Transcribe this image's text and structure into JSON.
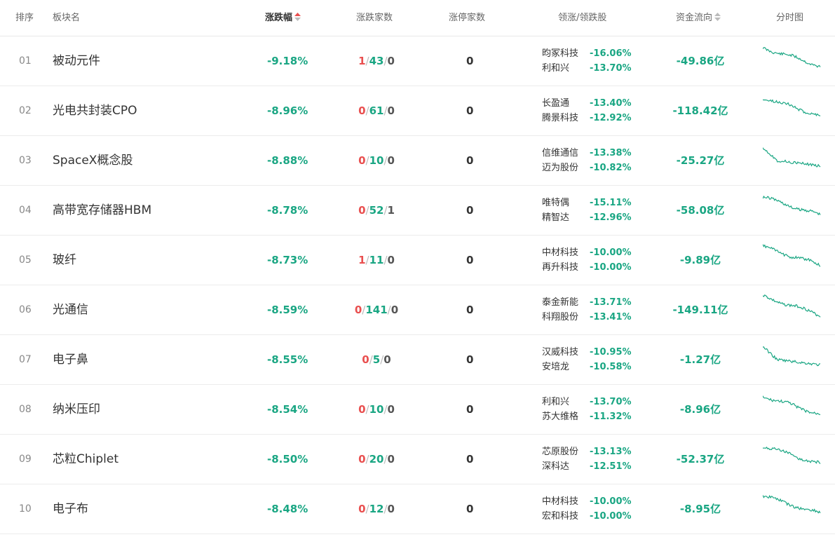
{
  "headers": {
    "rank": "排序",
    "name": "板块名",
    "pct": "涨跌幅",
    "counts": "涨跌家数",
    "limit_up": "涨停家数",
    "leaders": "领涨/领跌股",
    "flow": "资金流向",
    "chart": "分时图"
  },
  "colors": {
    "down": "#1aa683",
    "up": "#e94f4f",
    "sort_active": "#e94f4f",
    "sort_inactive": "#bbbbbb"
  },
  "rows": [
    {
      "rank": "01",
      "name": "被动元件",
      "pct": "-9.18%",
      "up": "1",
      "down": "43",
      "flat": "0",
      "limit_up": "0",
      "leaders": [
        {
          "name": "昀冢科技",
          "pct": "-16.06%"
        },
        {
          "name": "利和兴",
          "pct": "-13.70%"
        }
      ],
      "flow": "-49.86亿"
    },
    {
      "rank": "02",
      "name": "光电共封装CPO",
      "pct": "-8.96%",
      "up": "0",
      "down": "61",
      "flat": "0",
      "limit_up": "0",
      "leaders": [
        {
          "name": "长盈通",
          "pct": "-13.40%"
        },
        {
          "name": "腾景科技",
          "pct": "-12.92%"
        }
      ],
      "flow": "-118.42亿"
    },
    {
      "rank": "03",
      "name": "SpaceX概念股",
      "pct": "-8.88%",
      "up": "0",
      "down": "10",
      "flat": "0",
      "limit_up": "0",
      "leaders": [
        {
          "name": "信维通信",
          "pct": "-13.38%"
        },
        {
          "name": "迈为股份",
          "pct": "-10.82%"
        }
      ],
      "flow": "-25.27亿"
    },
    {
      "rank": "04",
      "name": "高带宽存储器HBM",
      "pct": "-8.78%",
      "up": "0",
      "down": "52",
      "flat": "1",
      "limit_up": "0",
      "leaders": [
        {
          "name": "唯特偶",
          "pct": "-15.11%"
        },
        {
          "name": "精智达",
          "pct": "-12.96%"
        }
      ],
      "flow": "-58.08亿"
    },
    {
      "rank": "05",
      "name": "玻纤",
      "pct": "-8.73%",
      "up": "1",
      "down": "11",
      "flat": "0",
      "limit_up": "0",
      "leaders": [
        {
          "name": "中材科技",
          "pct": "-10.00%"
        },
        {
          "name": "再升科技",
          "pct": "-10.00%"
        }
      ],
      "flow": "-9.89亿"
    },
    {
      "rank": "06",
      "name": "光通信",
      "pct": "-8.59%",
      "up": "0",
      "down": "141",
      "flat": "0",
      "limit_up": "0",
      "leaders": [
        {
          "name": "泰金新能",
          "pct": "-13.71%"
        },
        {
          "name": "科翔股份",
          "pct": "-13.41%"
        }
      ],
      "flow": "-149.11亿"
    },
    {
      "rank": "07",
      "name": "电子鼻",
      "pct": "-8.55%",
      "up": "0",
      "down": "5",
      "flat": "0",
      "limit_up": "0",
      "leaders": [
        {
          "name": "汉威科技",
          "pct": "-10.95%"
        },
        {
          "name": "安培龙",
          "pct": "-10.58%"
        }
      ],
      "flow": "-1.27亿"
    },
    {
      "rank": "08",
      "name": "纳米压印",
      "pct": "-8.54%",
      "up": "0",
      "down": "10",
      "flat": "0",
      "limit_up": "0",
      "leaders": [
        {
          "name": "利和兴",
          "pct": "-13.70%"
        },
        {
          "name": "苏大维格",
          "pct": "-11.32%"
        }
      ],
      "flow": "-8.96亿"
    },
    {
      "rank": "09",
      "name": "芯粒Chiplet",
      "pct": "-8.50%",
      "up": "0",
      "down": "20",
      "flat": "0",
      "limit_up": "0",
      "leaders": [
        {
          "name": "芯原股份",
          "pct": "-13.13%"
        },
        {
          "name": "深科达",
          "pct": "-12.51%"
        }
      ],
      "flow": "-52.37亿"
    },
    {
      "rank": "10",
      "name": "电子布",
      "pct": "-8.48%",
      "up": "0",
      "down": "12",
      "flat": "0",
      "limit_up": "0",
      "leaders": [
        {
          "name": "中材科技",
          "pct": "-10.00%"
        },
        {
          "name": "宏和科技",
          "pct": "-10.00%"
        }
      ],
      "flow": "-8.95亿"
    }
  ]
}
